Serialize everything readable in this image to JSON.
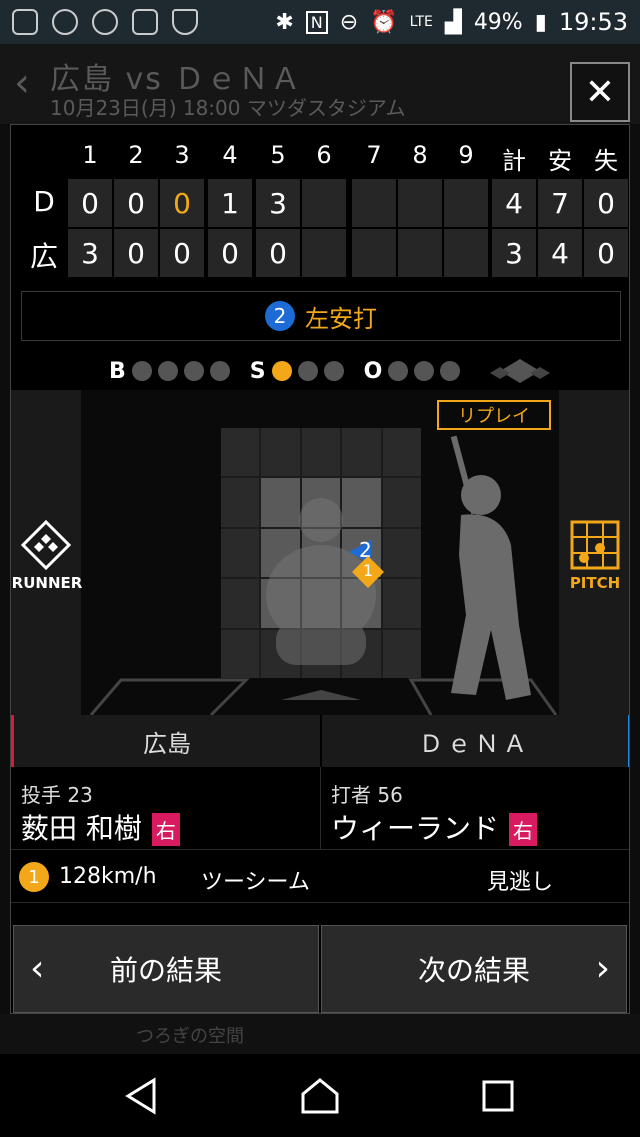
{
  "status_bar": {
    "battery": "49%",
    "time": "19:53",
    "network": "LTE"
  },
  "header": {
    "title": "広島 vs ＤｅＮＡ",
    "subtitle": "10月23日(月) 18:00 マツダスタジアム"
  },
  "scoreboard": {
    "columns": [
      "1",
      "2",
      "3",
      "4",
      "5",
      "6",
      "7",
      "8",
      "9",
      "計",
      "安",
      "失"
    ],
    "rows": [
      {
        "team": "D",
        "innings": [
          "0",
          "0",
          "0",
          "1",
          "3",
          "",
          "",
          "",
          ""
        ],
        "totals": [
          "4",
          "7",
          "0"
        ],
        "highlight_index": 2
      },
      {
        "team": "広",
        "innings": [
          "3",
          "0",
          "0",
          "0",
          "0",
          "",
          "",
          "",
          ""
        ],
        "totals": [
          "3",
          "4",
          "0"
        ]
      }
    ]
  },
  "play": {
    "number": "2",
    "result": "左安打"
  },
  "count": {
    "b_label": "B",
    "s_label": "S",
    "o_label": "O",
    "balls": 0,
    "strikes": 1,
    "outs": 0
  },
  "field": {
    "replay_label": "リプレイ",
    "runner_label": "RUNNER",
    "pitch_label": "PITCH",
    "pitches": [
      {
        "label": "2",
        "color": "#1e6bd6"
      },
      {
        "label": "1",
        "color": "#f2a818"
      }
    ]
  },
  "teams": {
    "home": "広島",
    "away": "ＤｅＮＡ"
  },
  "pitcher": {
    "label": "投手 23",
    "name": "薮田 和樹",
    "hand": "右"
  },
  "batter": {
    "label": "打者 56",
    "name": "ウィーランド",
    "hand": "右"
  },
  "pitch_detail": {
    "number": "1",
    "speed": "128km/h",
    "type": "ツーシーム",
    "result": "見逃し"
  },
  "nav": {
    "prev": "前の結果",
    "next": "次の結果"
  },
  "background_text": "つろぎの空間",
  "colors": {
    "accent": "#f2a818",
    "blue": "#1e6bd6",
    "hand_badge": "#d81b60"
  }
}
